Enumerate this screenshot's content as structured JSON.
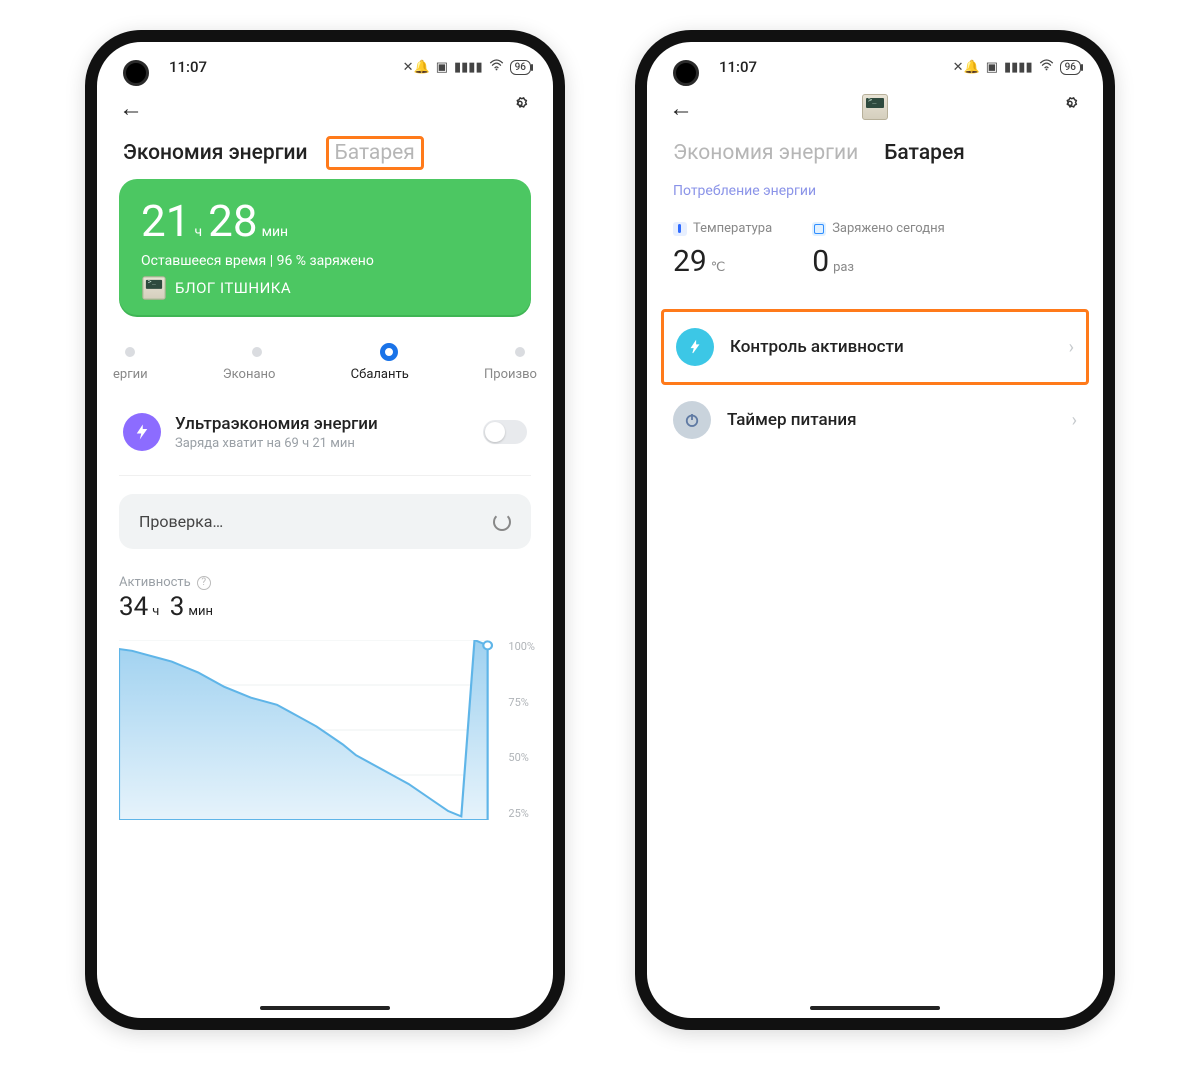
{
  "status_bar": {
    "time": "11:07",
    "battery_pill": "96"
  },
  "tabs": {
    "economy": "Экономия энергии",
    "battery": "Батарея"
  },
  "screen1": {
    "time_h": "21",
    "time_m": "28",
    "unit_h": "ч",
    "unit_m": "мин",
    "subtitle": "Оставшееся время | 96 % заряжено",
    "brand": "БЛОГ ІТШНИКА",
    "slider": {
      "a": "ергии",
      "b": "Эконано",
      "c": "Сбаланть",
      "d": "Произво"
    },
    "ultra_title": "Ультраэкономия энергии",
    "ultra_sub": "Заряда хватит на 69 ч 21 мин",
    "checking": "Проверка…",
    "activity_label": "Активность",
    "activity_h": "34",
    "activity_m": "3"
  },
  "screen2": {
    "section": "Потребление энергии",
    "temp_label": "Температура",
    "temp_value": "29",
    "temp_unit": "℃",
    "charged_label": "Заряжено сегодня",
    "charged_value": "0",
    "charged_unit": "раз",
    "row_activity": "Контроль активности",
    "row_timer": "Таймер питания"
  },
  "chart_data": {
    "type": "area",
    "x": [
      0,
      1,
      2,
      3,
      4,
      5,
      6,
      7,
      8,
      9,
      10,
      11,
      12,
      13,
      14,
      15,
      16,
      17,
      18,
      19,
      20,
      21,
      22,
      23,
      24,
      25,
      26,
      27,
      28
    ],
    "values": [
      95,
      94,
      92,
      90,
      88,
      85,
      82,
      78,
      74,
      71,
      68,
      66,
      64,
      60,
      56,
      52,
      47,
      42,
      36,
      32,
      28,
      24,
      20,
      15,
      10,
      5,
      2,
      100,
      97
    ],
    "ylim": [
      0,
      100
    ],
    "tick_labels": [
      "100%",
      "75%",
      "50%",
      "25%"
    ],
    "title": "",
    "xlabel": "",
    "ylabel": ""
  }
}
